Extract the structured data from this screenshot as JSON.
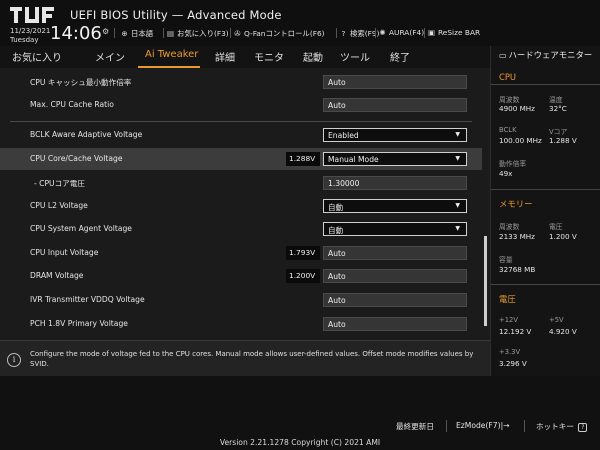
{
  "header": {
    "title": "UEFI BIOS Utility — Advanced Mode",
    "date": "11/23/2021",
    "day": "Tuesday",
    "time": "14:06",
    "tools": [
      {
        "icon": "globe-icon",
        "label": "日本語"
      },
      {
        "icon": "favorites-icon",
        "label": "お気に入り(F3)"
      },
      {
        "icon": "fan-icon",
        "label": "Q-Fanコントロール(F6)"
      },
      {
        "icon": "help-icon",
        "label": "検索(F9)"
      },
      {
        "icon": "aura-icon",
        "label": "AURA(F4)"
      },
      {
        "icon": "resize-bar-icon",
        "label": "ReSize BAR"
      }
    ]
  },
  "menu": {
    "items": [
      "お気に入り",
      "メイン",
      "Ai Tweaker",
      "詳細",
      "モニタ",
      "起動",
      "ツール",
      "終了"
    ],
    "active": "Ai Tweaker"
  },
  "settings": [
    {
      "label": "CPU キャッシュ最小動作倍率",
      "value": "Auto"
    },
    {
      "label": "Max. CPU Cache Ratio",
      "value": "Auto"
    },
    {
      "label": "BCLK Aware Adaptive Voltage",
      "value": "Enabled"
    },
    {
      "label": "CPU Core/Cache Voltage",
      "value": "Manual Mode",
      "readout": "1.288V"
    },
    {
      "label": "- CPUコア電圧",
      "value": "1.30000"
    },
    {
      "label": "CPU L2 Voltage",
      "value": "自動"
    },
    {
      "label": "CPU System Agent Voltage",
      "value": "自動"
    },
    {
      "label": "CPU Input Voltage",
      "value": "Auto",
      "readout": "1.793V"
    },
    {
      "label": "DRAM Voltage",
      "value": "Auto",
      "readout": "1.200V"
    },
    {
      "label": "IVR Transmitter VDDQ Voltage",
      "value": "Auto"
    },
    {
      "label": "PCH 1.8V Primary Voltage",
      "value": "Auto"
    }
  ],
  "help_text": "Configure the mode of voltage fed to the CPU cores. Manual mode allows user-defined values. Offset mode modifies values by SVID.",
  "hardware_monitor": {
    "title": "ハードウェアモニター",
    "cpu": {
      "section": "CPU",
      "freq_label": "周波数",
      "freq_value": "4900 MHz",
      "temp_label": "温度",
      "temp_value": "32°C",
      "bclk_label": "BCLK",
      "bclk_value": "100.00 MHz",
      "vcore_label": "Vコア",
      "vcore_value": "1.288 V",
      "ratio_label": "動作倍率",
      "ratio_value": "49x"
    },
    "memory": {
      "section": "メモリー",
      "freq_label": "周波数",
      "freq_value": "2133 MHz",
      "volt_label": "電圧",
      "volt_value": "1.200 V",
      "cap_label": "容量",
      "cap_value": "32768 MB"
    },
    "voltage": {
      "section": "電圧",
      "v12_label": "+12V",
      "v12_value": "12.192 V",
      "v5_label": "+5V",
      "v5_value": "4.920 V",
      "v33_label": "+3.3V",
      "v33_value": "3.296 V"
    }
  },
  "bottom": {
    "last_modified": "最終更新日",
    "ezmode": "EzMode(F7)|→",
    "hotkeys": "ホットキー",
    "version": "Version 2.21.1278 Copyright (C) 2021 AMI"
  },
  "colors": {
    "accent": "#e99a2f",
    "background": "#1b1b1b",
    "selected_row": "#3c3c3c"
  }
}
